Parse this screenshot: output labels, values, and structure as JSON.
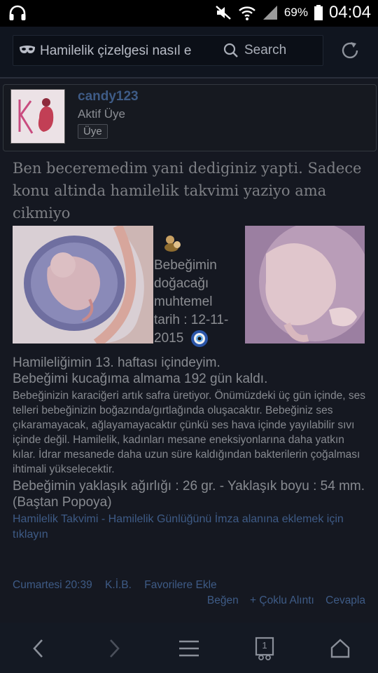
{
  "status_bar": {
    "battery_percent": "69%",
    "time": "04:04"
  },
  "browser": {
    "url_text": "Hamilelik çizelgesi nasıl e",
    "search_label": "Search"
  },
  "post": {
    "username": "candy123",
    "user_title": "Aktif Üye",
    "user_badge": "Üye",
    "message": "Ben beceremedim yani dediginiz yapti. Sadece konu altinda hamilelik takvimi yaziyo ama cikmiyo",
    "due_date_text": "Bebeğimin doğacağı muhtemel tarih : 12-11-2015",
    "signature": {
      "week_line": "Hamileliğimin 13. haftası içindeyim.",
      "days_line": "Bebeğimi kucağıma almama 192 gün kaldı.",
      "info_paragraph": "Bebeğinizin karaciğeri artık safra üretiyor. Önümüzdeki üç gün içinde, ses telleri bebeğinizin boğazında/gırtlağında oluşacaktır. Bebeğiniz ses çıkaramayacak, ağlayamayacaktır çünkü ses hava içinde yayılabilir sıvı içinde değil. Hamilelik, kadınları mesane eneksiyonlarına daha yatkın kılar. İdrar mesanede daha uzun süre kaldığından bakterilerin çoğalması ihtimali yükselecektir.",
      "size_line": "Bebeğimin yaklaşık ağırlığı : 26 gr. - Yaklaşık boyu : 54 mm. (Baştan Popoya)",
      "link_text": "Hamilelik Takvimi - Hamilelik Günlüğünü İmza alanına eklemek için tıklayın"
    },
    "meta": {
      "timestamp": "Cumartesi 20:39",
      "kib": "K.İ.B.",
      "favorite": "Favorilere Ekle"
    },
    "actions": {
      "like": "Beğen",
      "multi_quote": "+ Çoklu Alıntı",
      "reply": "Cevapla"
    }
  },
  "nav_bar": {
    "tab_count": "1"
  }
}
